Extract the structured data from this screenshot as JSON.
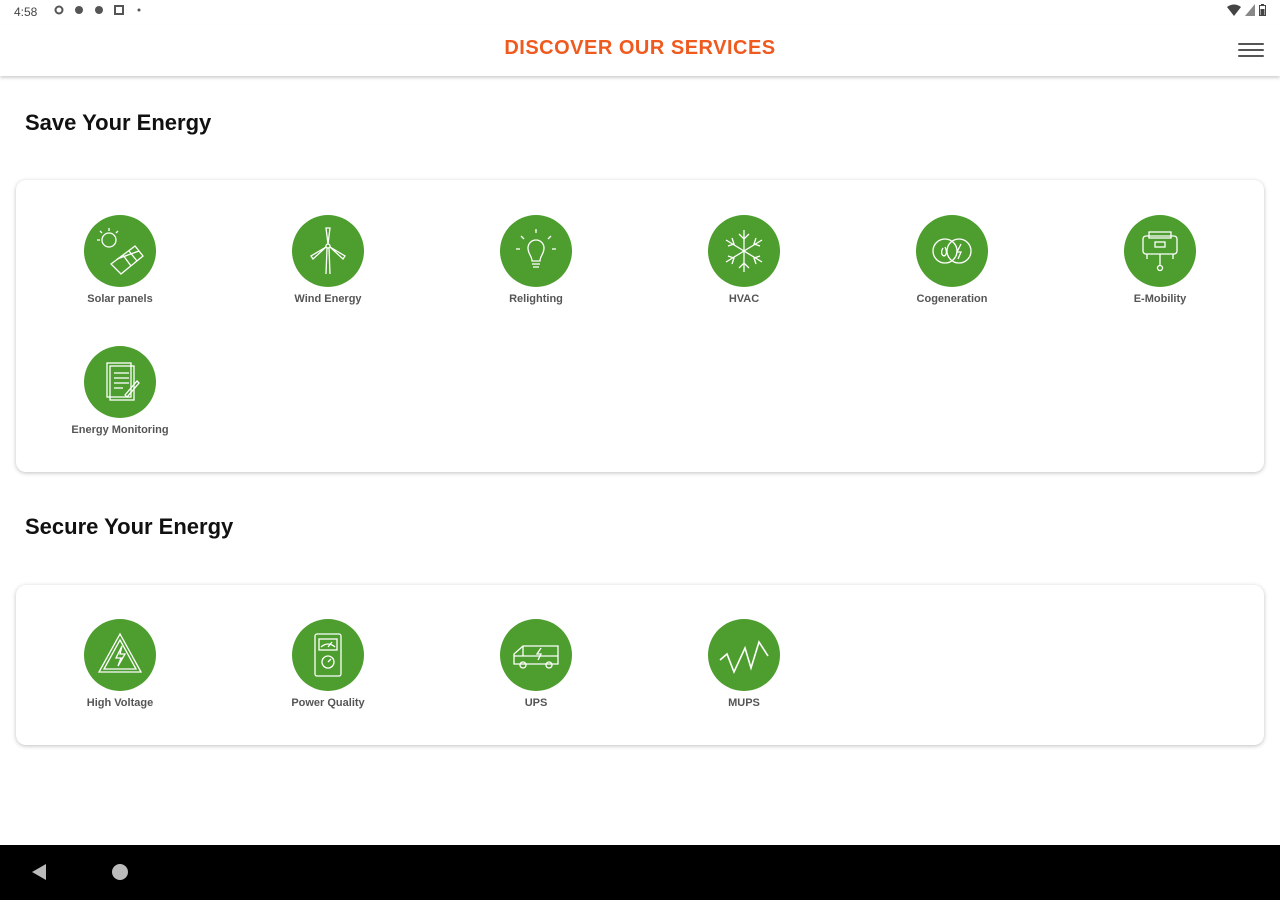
{
  "status_bar": {
    "time": "4:58"
  },
  "app_bar": {
    "title": "DISCOVER OUR SERVICES",
    "title_color": "#ef5a1f",
    "menu_icon": "hamburger-menu-icon"
  },
  "theme": {
    "icon_circle_color": "#4e9e2f"
  },
  "sections": [
    {
      "title": "Save Your Energy",
      "items": [
        {
          "label": "Solar panels",
          "icon": "solar-panel-icon"
        },
        {
          "label": "Wind Energy",
          "icon": "wind-turbine-icon"
        },
        {
          "label": "Relighting",
          "icon": "light-bulb-icon"
        },
        {
          "label": "HVAC",
          "icon": "snowflake-icon"
        },
        {
          "label": "Cogeneration",
          "icon": "cogeneration-icon"
        },
        {
          "label": "E-Mobility",
          "icon": "charging-station-icon"
        },
        {
          "label": "Energy Monitoring",
          "icon": "report-document-icon"
        }
      ]
    },
    {
      "title": "Secure Your Energy",
      "items": [
        {
          "label": "High Voltage",
          "icon": "high-voltage-warning-icon"
        },
        {
          "label": "Power Quality",
          "icon": "meter-icon"
        },
        {
          "label": "UPS",
          "icon": "ups-van-icon"
        },
        {
          "label": "MUPS",
          "icon": "waveform-icon"
        }
      ]
    }
  ]
}
